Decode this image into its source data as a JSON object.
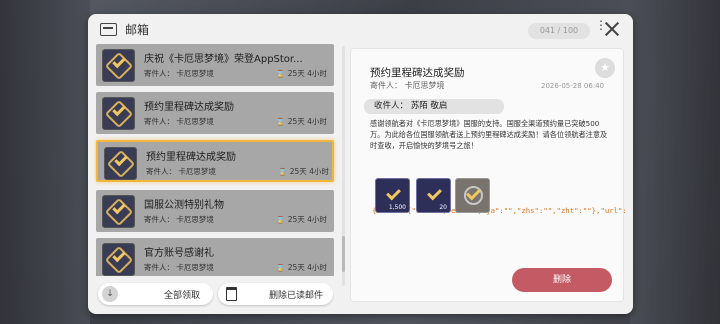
{
  "header": {
    "title": "邮箱",
    "counter": "041 / 100"
  },
  "mail_list": [
    {
      "title": "庆祝《卡厄思梦境》荣登AppStor...",
      "sender": "寄件人：  卡厄思梦境",
      "time": "25天 4小时"
    },
    {
      "title": "预约里程碑达成奖励",
      "sender": "寄件人：  卡厄思梦境",
      "time": "25天 4小时"
    },
    {
      "title": "预约里程碑达成奖励",
      "sender": "寄件人：  卡厄思梦境",
      "time": "25天 4小时",
      "selected": true
    },
    {
      "title": "国服公测特别礼物",
      "sender": "寄件人：  卡厄思梦境",
      "time": "25天 4小时"
    },
    {
      "title": "官方账号感谢礼",
      "sender": "寄件人：  卡厄思梦境",
      "time": "25天 4小时"
    }
  ],
  "buttons": {
    "collect_all": "全部领取",
    "delete_read": "删除已读邮件",
    "delete": "删除"
  },
  "detail": {
    "title": "预约里程碑达成奖励",
    "sender": "寄件人：  卡厄思梦境",
    "date": "2026-05-28 06:40",
    "recipient": "收件人：  苏陌 敬启",
    "body": "感谢领航者对《卡厄思梦境》国服的支持。国服全渠道预约量已突破500万。为此给各位国服领航者送上预约里程碑达成奖励！请各位领航者注意及时查收，开启愉快的梦境号之旅！",
    "raw_json": "{\"name\":{\"ko\":\"\",\"en\":\"\",\"ja\":\"\",\"zhs\":\"\",\"zht\":\"\"},\"url\":{\"ko\":\"\",\"en\":\"\",\"ja\":\"\",\"zhs\":\"\",\""
  },
  "rewards": [
    {
      "qty": "1,500"
    },
    {
      "qty": "20"
    },
    {
      "qty": ""
    }
  ],
  "icons": {
    "mail": "mail-icon",
    "close": "close-icon",
    "more": "more-icon",
    "star": "star-icon",
    "hourglass": "hourglass-icon",
    "trash": "trash-icon",
    "download": "download-icon"
  },
  "colors": {
    "selected_border": "#f3b63c",
    "delete_button": "#c45b64",
    "json_text": "#e0701c"
  }
}
